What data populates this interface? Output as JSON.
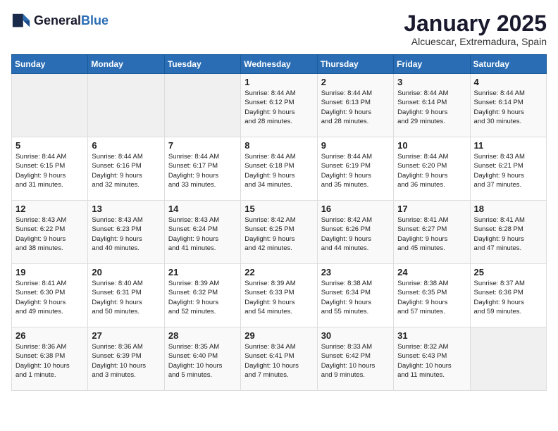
{
  "header": {
    "logo_general": "General",
    "logo_blue": "Blue",
    "month": "January 2025",
    "location": "Alcuescar, Extremadura, Spain"
  },
  "weekdays": [
    "Sunday",
    "Monday",
    "Tuesday",
    "Wednesday",
    "Thursday",
    "Friday",
    "Saturday"
  ],
  "weeks": [
    [
      {
        "day": "",
        "info": ""
      },
      {
        "day": "",
        "info": ""
      },
      {
        "day": "",
        "info": ""
      },
      {
        "day": "1",
        "info": "Sunrise: 8:44 AM\nSunset: 6:12 PM\nDaylight: 9 hours\nand 28 minutes."
      },
      {
        "day": "2",
        "info": "Sunrise: 8:44 AM\nSunset: 6:13 PM\nDaylight: 9 hours\nand 28 minutes."
      },
      {
        "day": "3",
        "info": "Sunrise: 8:44 AM\nSunset: 6:14 PM\nDaylight: 9 hours\nand 29 minutes."
      },
      {
        "day": "4",
        "info": "Sunrise: 8:44 AM\nSunset: 6:14 PM\nDaylight: 9 hours\nand 30 minutes."
      }
    ],
    [
      {
        "day": "5",
        "info": "Sunrise: 8:44 AM\nSunset: 6:15 PM\nDaylight: 9 hours\nand 31 minutes."
      },
      {
        "day": "6",
        "info": "Sunrise: 8:44 AM\nSunset: 6:16 PM\nDaylight: 9 hours\nand 32 minutes."
      },
      {
        "day": "7",
        "info": "Sunrise: 8:44 AM\nSunset: 6:17 PM\nDaylight: 9 hours\nand 33 minutes."
      },
      {
        "day": "8",
        "info": "Sunrise: 8:44 AM\nSunset: 6:18 PM\nDaylight: 9 hours\nand 34 minutes."
      },
      {
        "day": "9",
        "info": "Sunrise: 8:44 AM\nSunset: 6:19 PM\nDaylight: 9 hours\nand 35 minutes."
      },
      {
        "day": "10",
        "info": "Sunrise: 8:44 AM\nSunset: 6:20 PM\nDaylight: 9 hours\nand 36 minutes."
      },
      {
        "day": "11",
        "info": "Sunrise: 8:43 AM\nSunset: 6:21 PM\nDaylight: 9 hours\nand 37 minutes."
      }
    ],
    [
      {
        "day": "12",
        "info": "Sunrise: 8:43 AM\nSunset: 6:22 PM\nDaylight: 9 hours\nand 38 minutes."
      },
      {
        "day": "13",
        "info": "Sunrise: 8:43 AM\nSunset: 6:23 PM\nDaylight: 9 hours\nand 40 minutes."
      },
      {
        "day": "14",
        "info": "Sunrise: 8:43 AM\nSunset: 6:24 PM\nDaylight: 9 hours\nand 41 minutes."
      },
      {
        "day": "15",
        "info": "Sunrise: 8:42 AM\nSunset: 6:25 PM\nDaylight: 9 hours\nand 42 minutes."
      },
      {
        "day": "16",
        "info": "Sunrise: 8:42 AM\nSunset: 6:26 PM\nDaylight: 9 hours\nand 44 minutes."
      },
      {
        "day": "17",
        "info": "Sunrise: 8:41 AM\nSunset: 6:27 PM\nDaylight: 9 hours\nand 45 minutes."
      },
      {
        "day": "18",
        "info": "Sunrise: 8:41 AM\nSunset: 6:28 PM\nDaylight: 9 hours\nand 47 minutes."
      }
    ],
    [
      {
        "day": "19",
        "info": "Sunrise: 8:41 AM\nSunset: 6:30 PM\nDaylight: 9 hours\nand 49 minutes."
      },
      {
        "day": "20",
        "info": "Sunrise: 8:40 AM\nSunset: 6:31 PM\nDaylight: 9 hours\nand 50 minutes."
      },
      {
        "day": "21",
        "info": "Sunrise: 8:39 AM\nSunset: 6:32 PM\nDaylight: 9 hours\nand 52 minutes."
      },
      {
        "day": "22",
        "info": "Sunrise: 8:39 AM\nSunset: 6:33 PM\nDaylight: 9 hours\nand 54 minutes."
      },
      {
        "day": "23",
        "info": "Sunrise: 8:38 AM\nSunset: 6:34 PM\nDaylight: 9 hours\nand 55 minutes."
      },
      {
        "day": "24",
        "info": "Sunrise: 8:38 AM\nSunset: 6:35 PM\nDaylight: 9 hours\nand 57 minutes."
      },
      {
        "day": "25",
        "info": "Sunrise: 8:37 AM\nSunset: 6:36 PM\nDaylight: 9 hours\nand 59 minutes."
      }
    ],
    [
      {
        "day": "26",
        "info": "Sunrise: 8:36 AM\nSunset: 6:38 PM\nDaylight: 10 hours\nand 1 minute."
      },
      {
        "day": "27",
        "info": "Sunrise: 8:36 AM\nSunset: 6:39 PM\nDaylight: 10 hours\nand 3 minutes."
      },
      {
        "day": "28",
        "info": "Sunrise: 8:35 AM\nSunset: 6:40 PM\nDaylight: 10 hours\nand 5 minutes."
      },
      {
        "day": "29",
        "info": "Sunrise: 8:34 AM\nSunset: 6:41 PM\nDaylight: 10 hours\nand 7 minutes."
      },
      {
        "day": "30",
        "info": "Sunrise: 8:33 AM\nSunset: 6:42 PM\nDaylight: 10 hours\nand 9 minutes."
      },
      {
        "day": "31",
        "info": "Sunrise: 8:32 AM\nSunset: 6:43 PM\nDaylight: 10 hours\nand 11 minutes."
      },
      {
        "day": "",
        "info": ""
      }
    ]
  ]
}
